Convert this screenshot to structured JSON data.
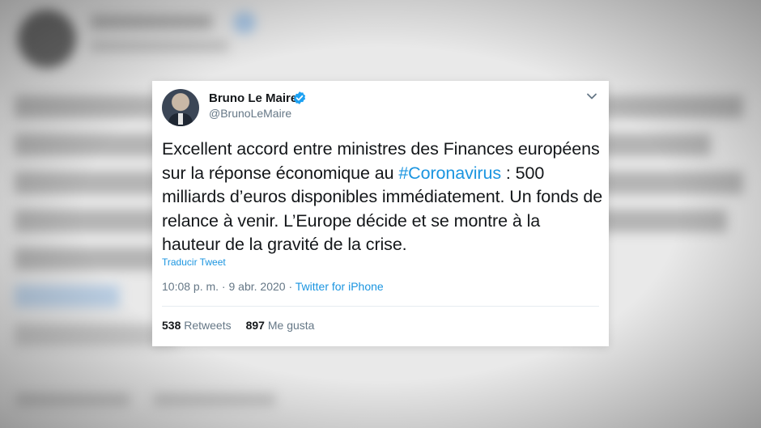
{
  "tweet": {
    "author_name": "Bruno Le Maire",
    "author_handle": "@BrunoLeMaire",
    "text_before": "Excellent accord entre ministres des Finances européens sur la réponse économique au ",
    "hashtag": "#Coronavirus",
    "text_after": " : 500 milliards d’euros disponibles immédiatement. Un fonds de relance à venir. L’Europe décide et se montre à la hauteur de la gravité de la crise.",
    "translate_label": "Traducir Tweet",
    "time": "10:08 p. m.",
    "separator": " · ",
    "date": "9 abr. 2020",
    "source": "Twitter for iPhone",
    "retweets_count": "538",
    "retweets_label": "Retweets",
    "likes_count": "897",
    "likes_label": "Me gusta"
  },
  "icons": {
    "verified": "verified-badge-icon",
    "menu": "chevron-down-icon"
  },
  "colors": {
    "link": "#1b95e0",
    "text": "#14171a",
    "secondary": "#657786"
  }
}
